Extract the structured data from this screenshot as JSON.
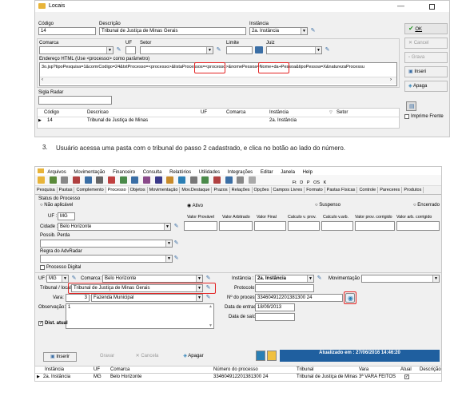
{
  "win1": {
    "title": "Locais",
    "labels": {
      "codigo": "Código",
      "descricao": "Descrição",
      "instancia": "Instância",
      "comarca": "Comarca",
      "uf": "UF",
      "setor": "Setor",
      "limite": "Limite",
      "juiz": "Juiz",
      "endereco": "Endereço HTML (Use <processo> como parâmetro)",
      "sigla": "Sigla Radar"
    },
    "values": {
      "codigo": "14",
      "descricao": "Tribunal de Justiça de Minas Gerais",
      "instancia": "2a. Instância",
      "url": "3o.jsp?tipoPesquisa=1&comrCodigo=24&txtProcesso=<processo>&listaProcessos=<processo>&nomePessoa=Nome+da+Pessoa&tipoPessoa=X&naturezaProcessu"
    },
    "buttons": {
      "ok": "OK",
      "cancel": "Cancel",
      "gravar": "Grava",
      "inserir": "Inseri",
      "apagar": "Apaga"
    },
    "grid": {
      "headers": [
        "Código",
        "Descricao",
        "UF",
        "Comarca",
        "Instância",
        "Setor"
      ],
      "row": [
        "14",
        "Tribunal de Justiça de Minas",
        "",
        "",
        "2a. Instância",
        ""
      ]
    },
    "print_label": "Imprime Frente"
  },
  "step": {
    "number": "3.",
    "text": "Usuário acessa uma pasta com o tribunal do passo 2 cadastrado, e clica no botão ao lado do número."
  },
  "win2": {
    "menu": [
      "Arquivos",
      "Movimentação",
      "Financeiro",
      "Consulta",
      "Relatórios",
      "Utilidades",
      "Integrações",
      "Editar",
      "Janela",
      "Help"
    ],
    "toolbar_right": [
      "Ft",
      "D",
      "P",
      "OS",
      "K"
    ],
    "tabs": [
      "Pesquisa",
      "Pastas",
      "Complemento",
      "Processo",
      "Objetos",
      "Movimentação",
      "Mov.Destaque",
      "Prazos",
      "Relações",
      "Opções",
      "Campos Livres",
      "Formato",
      "Pastas Físicas",
      "Controle",
      "Pareceres",
      "Produtos"
    ],
    "status_label": "Status do Processo",
    "radios": [
      "Não aplicável",
      "Ativo",
      "Suspenso",
      "Encerrado"
    ],
    "labels": {
      "uf": "UF :",
      "cidade": "Cidade :",
      "possib": "Possib. Perda",
      "regra": "Regra do AdvRadar",
      "proc_digital": "Processo Digital",
      "uf2": "UF:",
      "comarca": "Comarca:",
      "tribunal": "Tribunal / local:",
      "vara": "Vara:",
      "obs": "Observação:",
      "dist": "Dist. atual",
      "instancia": "Instância :",
      "protocolo": "Protocolo:",
      "nprocesso": "Nº do processo:",
      "data_entrada": "Data de entrada:",
      "data_saida": "Data de saída:",
      "movimentacao": "Movimentação :"
    },
    "value_cols": [
      "Valor Provável",
      "Valor Arbitrado",
      "Valor Final",
      "Calculo v. prov.",
      "Calculo v.arb.",
      "Valor prov. corrigido",
      "Valor arb. corrigido"
    ],
    "values": {
      "uf": "MG",
      "cidade": "Belo Horizonte",
      "uf2": "MG",
      "comarca": "Belo Horizonte",
      "tribunal": "Tribunal de Justiça de Minas Gerais",
      "vara_num": "3",
      "vara": "Fazenda Municipal",
      "obs": "1",
      "instancia": "2a. Instância",
      "nprocesso": "334604912201381300 24",
      "data_entrada": "18/09/2013"
    },
    "buttons": {
      "inserir": "Inserir",
      "gravar": "Gravar",
      "cancela": "Cancela",
      "apagar": "Apagar"
    },
    "updated": "Atualizado em : 27/06/2016 14:46:20",
    "grid": {
      "headers": [
        "Instância",
        "UF",
        "Comarca",
        "Número do processo",
        "Tribunal",
        "Vara",
        "Atual",
        "Descrição"
      ],
      "row": [
        "2a. Instância",
        "MG",
        "Belo Horizonte",
        "334604912201381300 24",
        "Tribunal de Justiça de Minas",
        "3ª VARA FEITOS",
        "",
        ""
      ]
    }
  }
}
